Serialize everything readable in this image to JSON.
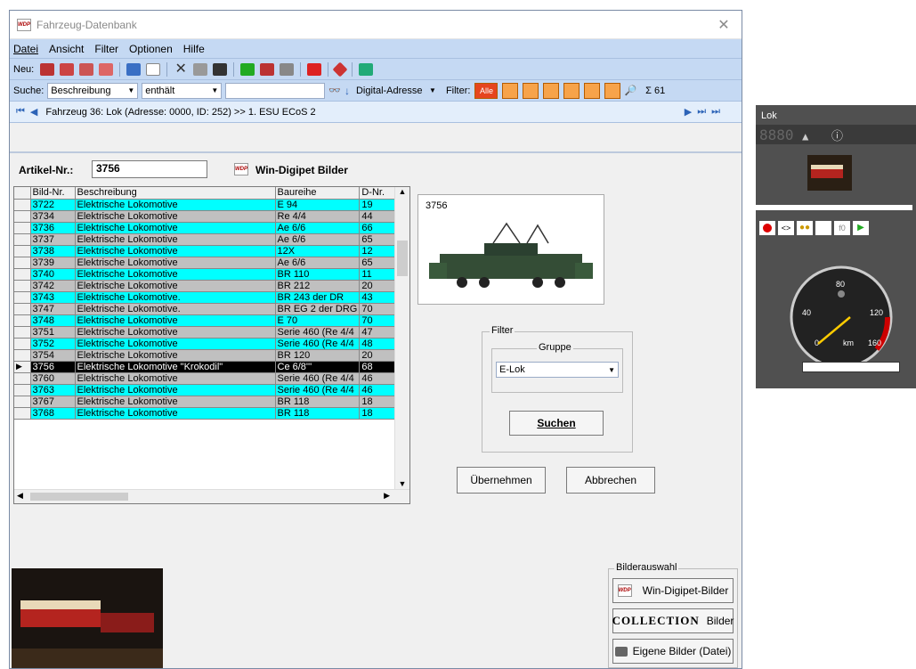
{
  "window": {
    "title": "Fahrzeug-Datenbank",
    "close": "✕"
  },
  "menu": [
    "Datei",
    "Ansicht",
    "Filter",
    "Optionen",
    "Hilfe"
  ],
  "toolbar": {
    "new_label": "Neu:"
  },
  "search": {
    "label": "Suche:",
    "field": "Beschreibung",
    "operator": "enthält",
    "value": "",
    "sort_field": "Digital-Adresse",
    "filter_label": "Filter:",
    "filter_all": "Alle",
    "sum_label": "Σ 61"
  },
  "nav": {
    "text": "Fahrzeug 36: Lok (Adresse: 0000, ID: 252) >> 1. ESU ECoS 2"
  },
  "article": {
    "label": "Artikel-Nr.:",
    "value": "3756",
    "wdp_label": "Win-Digipet Bilder"
  },
  "table": {
    "headers": [
      "Bild-Nr.",
      "Beschreibung",
      "Baureihe",
      "D-Nr."
    ],
    "rows": [
      {
        "nr": "3722",
        "desc": "Elektrische Lokomotive",
        "br": "E 94",
        "dnr": "19",
        "style": "cyan"
      },
      {
        "nr": "3734",
        "desc": "Elektrische Lokomotive",
        "br": "Re 4/4",
        "dnr": "44",
        "style": "gray"
      },
      {
        "nr": "3736",
        "desc": "Elektrische Lokomotive",
        "br": "Ae 6/6",
        "dnr": "66",
        "style": "cyan"
      },
      {
        "nr": "3737",
        "desc": "Elektrische Lokomotive",
        "br": "Ae 6/6",
        "dnr": "65",
        "style": "gray"
      },
      {
        "nr": "3738",
        "desc": "Elektrische Lokomotive",
        "br": "12X",
        "dnr": "12",
        "style": "cyan"
      },
      {
        "nr": "3739",
        "desc": "Elektrische Lokomotive",
        "br": "Ae 6/6",
        "dnr": "65",
        "style": "gray"
      },
      {
        "nr": "3740",
        "desc": "Elektrische Lokomotive",
        "br": "BR 110",
        "dnr": "11",
        "style": "cyan"
      },
      {
        "nr": "3742",
        "desc": "Elektrische Lokomotive",
        "br": "BR 212",
        "dnr": "20",
        "style": "gray"
      },
      {
        "nr": "3743",
        "desc": "Elektrische Lokomotive.",
        "br": "BR 243 der DR",
        "dnr": "43",
        "style": "cyan"
      },
      {
        "nr": "3747",
        "desc": "Elektrische Lokomotive.",
        "br": "BR EG 2 der DRG",
        "dnr": "70",
        "style": "gray"
      },
      {
        "nr": "3748",
        "desc": "Elektrische Lokomotive",
        "br": "E 70",
        "dnr": "70",
        "style": "cyan"
      },
      {
        "nr": "3751",
        "desc": "Elektrische Lokomotive",
        "br": "Serie 460 (Re 4/4",
        "dnr": "47",
        "style": "gray"
      },
      {
        "nr": "3752",
        "desc": "Elektrische Lokomotive",
        "br": "Serie 460 (Re 4/4",
        "dnr": "48",
        "style": "cyan"
      },
      {
        "nr": "3754",
        "desc": "Elektrische Lokomotive",
        "br": "BR 120",
        "dnr": "20",
        "style": "gray"
      },
      {
        "nr": "3756",
        "desc": "Elektrische Lokomotive \"Krokodil\"",
        "br": "Ce 6/8'''",
        "dnr": "68",
        "style": "sel"
      },
      {
        "nr": "3760",
        "desc": "Elektrische Lokomotive",
        "br": "Serie 460 (Re 4/4",
        "dnr": "46",
        "style": "gray"
      },
      {
        "nr": "3763",
        "desc": "Elektrische Lokomotive",
        "br": "Serie 460 (Re 4/4",
        "dnr": "46",
        "style": "cyan"
      },
      {
        "nr": "3767",
        "desc": "Elektrische Lokomotive",
        "br": "BR 118",
        "dnr": "18",
        "style": "gray"
      },
      {
        "nr": "3768",
        "desc": "Elektrische Lokomotive",
        "br": "BR 118",
        "dnr": "18",
        "style": "cyan"
      }
    ]
  },
  "preview": {
    "caption": "3756"
  },
  "filter": {
    "group_title": "Filter",
    "gruppe_label": "Gruppe",
    "gruppe_value": "E-Lok",
    "search_button": "Suchen"
  },
  "buttons": {
    "apply": "Übernehmen",
    "cancel": "Abbrechen"
  },
  "bilderauswahl": {
    "title": "Bilderauswahl",
    "wdp": "Win-Digipet-Bilder",
    "collection_logo": "COLLECTION",
    "collection": "Bilder",
    "own": "Eigene Bilder (Datei)"
  },
  "lok_panel": {
    "title": "Lok",
    "speed_digits": "8880",
    "speed_value": "0",
    "f0": "f0",
    "gauge_unit": "km",
    "gauge_ticks": [
      "40",
      "80",
      "120",
      "160",
      "0"
    ]
  },
  "colors": {
    "cyan": "#00ffff",
    "gray": "#c0c0c0",
    "toolbar": "#c5d9f3"
  }
}
